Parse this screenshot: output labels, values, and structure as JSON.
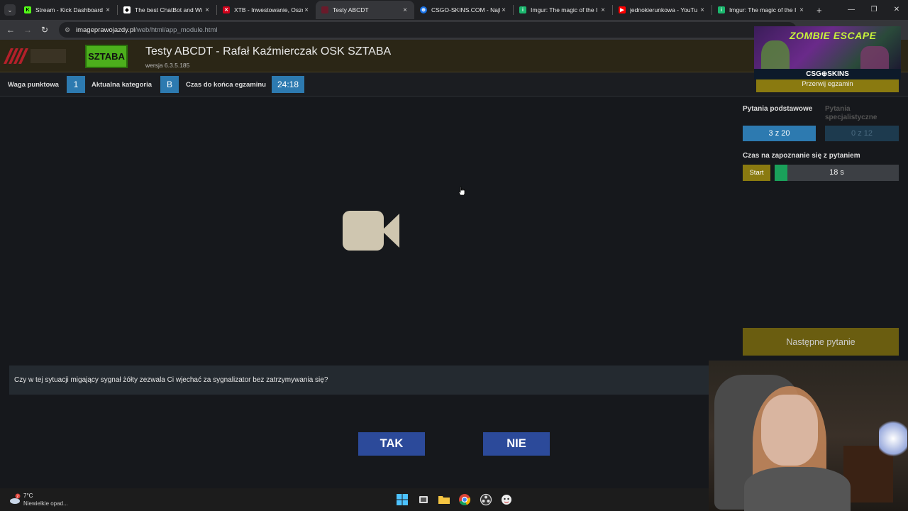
{
  "browser": {
    "tabs": [
      {
        "title": "Stream - Kick Dashboard",
        "icon": "kick-icon",
        "active": false
      },
      {
        "title": "The best ChatBot and Wi",
        "icon": "botrix-icon",
        "active": false
      },
      {
        "title": "XTB - Inwestowanie, Oszc",
        "icon": "xtb-icon",
        "active": false
      },
      {
        "title": "Testy ABCDT",
        "icon": "site-icon",
        "active": true
      },
      {
        "title": "CSGO-SKINS.COM - Najle",
        "icon": "csgo-skins-icon",
        "active": false
      },
      {
        "title": "Imgur: The magic of the I",
        "icon": "imgur-icon",
        "active": false
      },
      {
        "title": "jednokierunkowa - YouTu",
        "icon": "youtube-icon",
        "active": false
      },
      {
        "title": "Imgur: The magic of the I",
        "icon": "imgur-icon",
        "active": false
      }
    ],
    "tab_close": "×",
    "new_tab": "+",
    "url_site": "imageprawojazdy.pl",
    "url_path": "/web/html/app_module.html"
  },
  "header": {
    "title": "Testy ABCDT - Rafał Kaźmierczak OSK SZTABA",
    "version": "wersja 6.3.5.185",
    "logo_text": "SZTABA"
  },
  "infobar": {
    "weight_label": "Waga punktowa",
    "weight_value": "1",
    "category_label": "Aktualna kategoria",
    "category_value": "B",
    "time_label": "Czas do końca egzaminu",
    "time_value": "24:18"
  },
  "overlay": {
    "game_title": "ZOMBIE ESCAPE",
    "brand": "CSG⊕SKINS"
  },
  "right_panel": {
    "stop_exam": "Przerwij egzamin",
    "basic_label": "Pytania podstawowe",
    "basic_counter": "3 z 20",
    "specialist_label": "Pytania specjalistyczne",
    "specialist_counter": "0 z 12",
    "read_time_label": "Czas na zapoznanie się z pytaniem",
    "start_button": "Start",
    "read_time_value": "18 s",
    "read_time_fraction": 0.1,
    "next_button": "Następne pytanie"
  },
  "question": {
    "text": "Czy w tej sytuacji migający sygnał żółty zezwala Ci wjechać za sygnalizator bez zatrzymywania się?",
    "yes_label": "TAK",
    "no_label": "NIE"
  },
  "taskbar": {
    "temperature": "7°C",
    "weather_desc": "Niewielkie opad...",
    "weather_badge": "2"
  },
  "colors": {
    "accent_blue": "#2d7ab0",
    "gold": "#8a7a10",
    "answer_blue": "#2c4a9a",
    "progress_green": "#1aa05a"
  }
}
